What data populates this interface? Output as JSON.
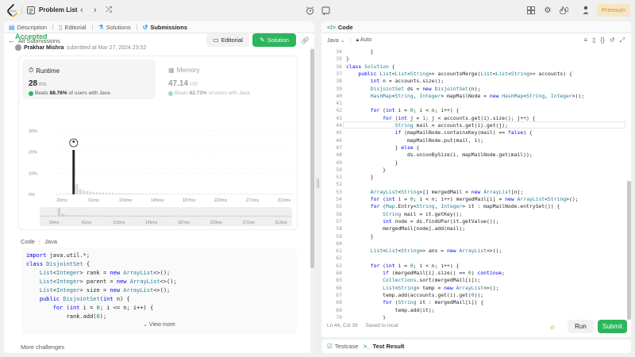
{
  "topbar": {
    "title": "Problem List",
    "prev_arrow": "‹",
    "next_arrow": "›",
    "shuffle": "⤮",
    "fire_count": "0",
    "premium_label": "Premium"
  },
  "left_tabs": [
    {
      "label": "Description",
      "icon": "description-icon"
    },
    {
      "label": "Editorial",
      "icon": "editorial-icon"
    },
    {
      "label": "Solutions",
      "icon": "solutions-icon"
    },
    {
      "label": "Submissions",
      "icon": "submissions-icon",
      "active": true
    }
  ],
  "submission": {
    "back_label": "All Submissions",
    "status": "Accepted",
    "author": "Prakhar Mishra",
    "submitted_at": "submitted at Mar 27, 2024 23:52",
    "editorial_button": "Editorial",
    "solution_button": "Solution"
  },
  "runtime": {
    "label": "Runtime",
    "value": "28",
    "unit": "ms",
    "beats_prefix": "Beats",
    "beats_value": "88.76%",
    "beats_suffix": "of users with Java"
  },
  "memory": {
    "label": "Memory",
    "value": "47.14",
    "unit": "MB",
    "beats_prefix": "Beats",
    "beats_value": "82.73%",
    "beats_suffix": "of users with Java"
  },
  "chart_data": {
    "type": "bar",
    "y_ticks": [
      "30%",
      "20%",
      "10%",
      "0%"
    ],
    "ylim": [
      0,
      30
    ],
    "x_ticks": [
      "20ms",
      "61ms",
      "103ms",
      "145ms",
      "187ms",
      "229ms",
      "271ms",
      "313ms"
    ],
    "minimap_ticks": [
      "20ms",
      "61ms",
      "103ms",
      "145ms",
      "187ms",
      "229ms",
      "271ms",
      "313ms"
    ],
    "values": [
      0.2,
      0.2,
      0.2,
      0.3,
      0.3,
      21,
      5,
      2.5,
      1.8,
      1.5,
      1.3,
      1.1,
      1.0,
      0.9,
      0.9,
      0.8,
      0.7,
      0.7,
      0.6,
      0.6,
      0.5,
      0.5,
      0.5,
      0.4,
      0.4,
      0.4,
      0.3,
      0.3,
      0.3,
      0.3,
      0.3,
      0.2,
      0.2,
      0.2,
      0.2,
      0.2,
      0.2,
      0.2,
      0.2,
      0.2,
      0.2,
      0.2,
      0.2,
      0.2,
      0.2,
      0.2,
      0.2,
      0.2,
      0.2,
      0.2,
      0.2,
      0.2,
      0.2,
      0.2,
      0.2,
      0.2,
      0.2,
      0.2,
      0.2,
      0.2,
      0.2,
      0.2,
      0.2,
      0.2,
      0.2,
      0.2,
      0.2,
      0.2,
      0.2,
      0.2,
      0.2,
      0.2
    ],
    "highlight_index": 5
  },
  "code_preview": {
    "label": "Code",
    "lang": "Java",
    "lines": [
      "import java.util.*;",
      "class DisjointSet {",
      "    List<Integer> rank = new ArrayList<>();",
      "    List<Integer> parent = new ArrayList<>();",
      "    List<Integer> size = new ArrayList<>();",
      "    public DisjointSet(int n) {",
      "        for (int i = 0; i <= n; i++) {",
      "            rank.add(0);"
    ],
    "view_more": "View more"
  },
  "more_challenges": "More challenges",
  "editor": {
    "tab_label": "Code",
    "language": "Java",
    "auto_label": "Auto",
    "status": "Ln 44, Col 39",
    "saved": "Saved to local",
    "run_label": "Run",
    "submit_label": "Submit",
    "start_line": 34,
    "lines": [
      "        }",
      "}",
      "class Solution {",
      "    public List<List<String>> accountsMerge(List<List<String>> accounts) {",
      "        int n = accounts.size();",
      "        DisjointSet ds = new DisjointSet(n);",
      "        HashMap<String, Integer> mapMailNode = new HashMap<String, Integer>();",
      "",
      "        for (int i = 0; i < n; i++) {",
      "            for (int j = 1; j < accounts.get(i).size(); j++) {",
      "                String mail = accounts.get(i).get(j);",
      "                if (mapMailNode.containsKey(mail) == false) {",
      "                    mapMailNode.put(mail, i);",
      "                } else {",
      "                    ds.unionBySize(i, mapMailNode.get(mail));",
      "                }",
      "            }",
      "        }",
      "",
      "        ArrayList<String>[] mergedMail = new ArrayList[n];",
      "        for (int i = 0; i < n; i++) mergedMail[i] = new ArrayList<String>();",
      "        for (Map.Entry<String, Integer> it : mapMailNode.entrySet()) {",
      "            String mail = it.getKey();",
      "            int node = ds.findUPar(it.getValue());",
      "            mergedMail[node].add(mail);",
      "        }",
      "",
      "        List<List<String>> ans = new ArrayList<>();",
      "",
      "        for (int i = 0; i < n; i++) {",
      "            if (mergedMail[i].size() == 0) continue;",
      "            Collections.sort(mergedMail[i]);",
      "            List<String> temp = new ArrayList<>();",
      "            temp.add(accounts.get(i).get(0));",
      "            for (String it : mergedMail[i]) {",
      "                temp.add(it);",
      "            }"
    ]
  },
  "bottom_tabs": [
    {
      "label": "Testcase",
      "icon": "testcase-icon"
    },
    {
      "label": "Test Result",
      "icon": "test-result-icon",
      "active": true
    }
  ],
  "colors": {
    "accent_green": "#2db55d",
    "premium_orange": "#e08b00"
  }
}
